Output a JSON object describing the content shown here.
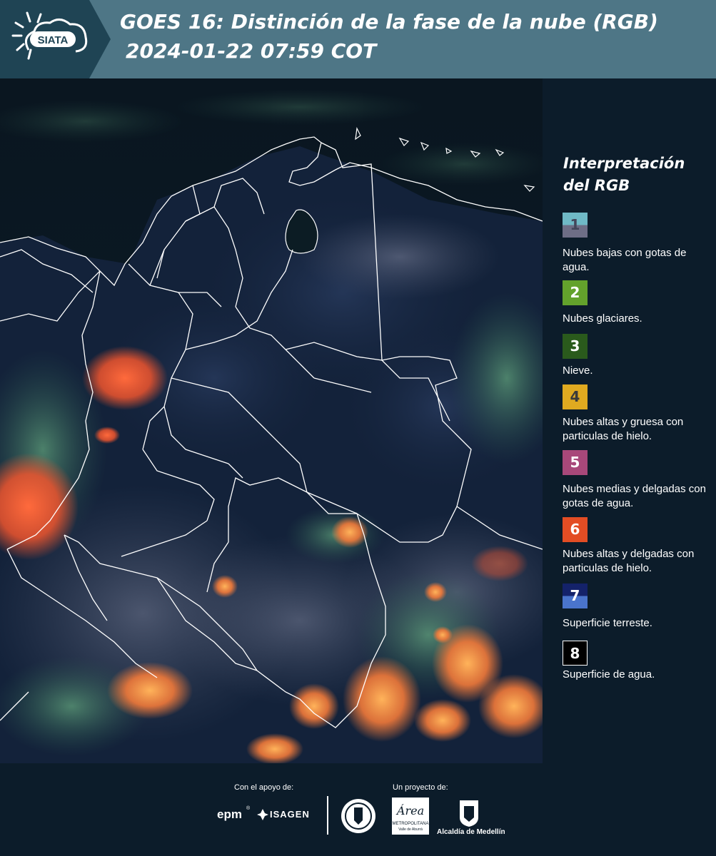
{
  "header": {
    "logo_text": "SIATA",
    "title_line1": "GOES 16: Distinción de la fase de la nube (RGB)",
    "title_line2": "2024-01-22 07:59 COT"
  },
  "legend": {
    "title": "Interpretación del RGB",
    "items": [
      {
        "number": "1",
        "label": "Nubes bajas con gotas de agua.",
        "color_top": "#6fb9c6",
        "color_bottom": "#6e6e86",
        "text_color": "#43465a"
      },
      {
        "number": "2",
        "label": "Nubes glaciares.",
        "color_top": "#63a22c",
        "color_bottom": "#63a22c",
        "text_color": "#ffffff"
      },
      {
        "number": "3",
        "label": "Nieve.",
        "color_top": "#2a5a1c",
        "color_bottom": "#2a5a1c",
        "text_color": "#ffffff"
      },
      {
        "number": "4",
        "label": "Nubes altas y gruesa con particulas de hielo.",
        "color_top": "#e0aa20",
        "color_bottom": "#e0aa20",
        "text_color": "#3a3a3a"
      },
      {
        "number": "5",
        "label": "Nubes medias y delgadas con gotas de agua.",
        "color_top": "#a8487a",
        "color_bottom": "#a8487a",
        "text_color": "#ffffff"
      },
      {
        "number": "6",
        "label": "Nubes altas y delgadas con particulas de hielo.",
        "color_top": "#e34d24",
        "color_bottom": "#e34d24",
        "text_color": "#ffffff"
      },
      {
        "number": "7",
        "label": "Superficie terreste.",
        "color_top": "#14226a",
        "color_bottom": "#4a74cc",
        "text_color": "#ffffff"
      },
      {
        "number": "8",
        "label": "Superficie de agua.",
        "color_top": "#000000",
        "color_bottom": "#000000",
        "text_color": "#ffffff"
      }
    ]
  },
  "footer": {
    "support_label": "Con el apoyo de:",
    "project_label": "Un proyecto de:",
    "sponsor_epm": "epm",
    "sponsor_isagen": "ISAGEN",
    "area_logo_text": "Área",
    "area_subtitle": "METROPOLITANA",
    "area_sub2": "Valle de Aburrá",
    "alcaldia": "Alcaldía de Medellín"
  }
}
